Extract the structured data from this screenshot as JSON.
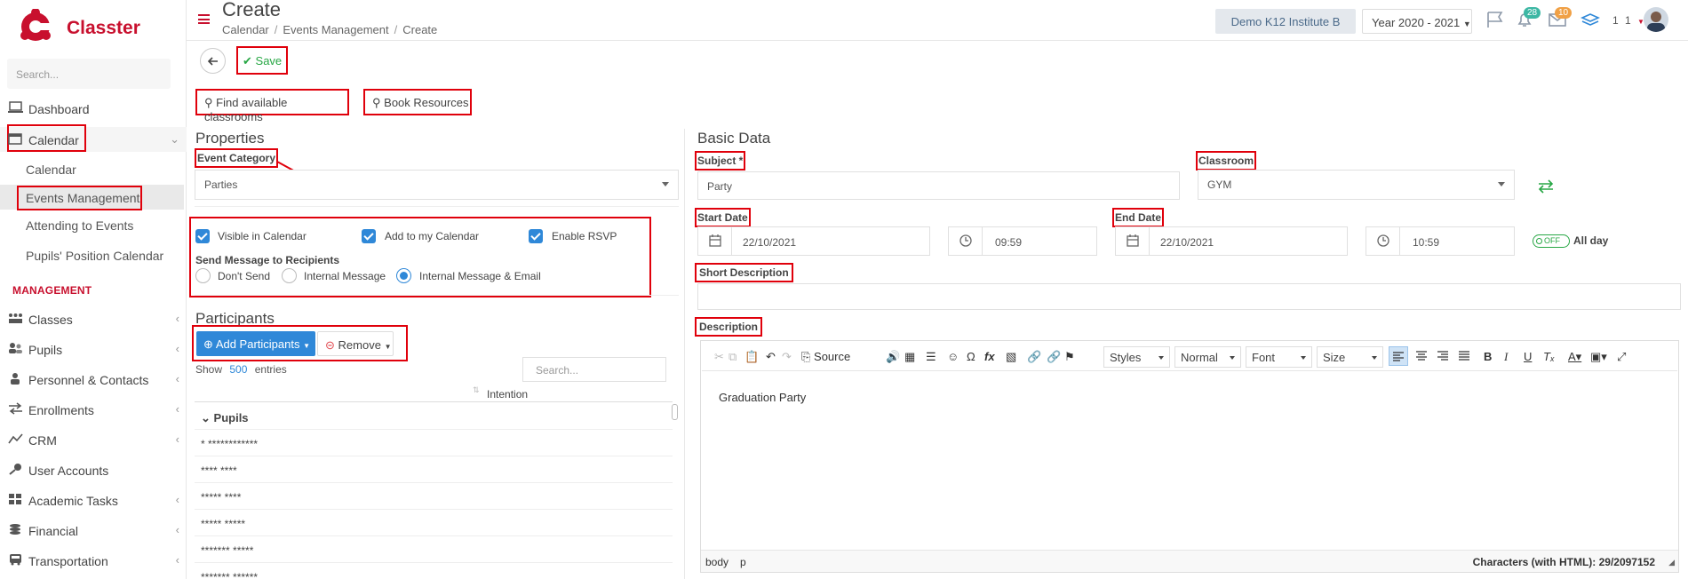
{
  "app": {
    "name": "Classter"
  },
  "sidebar": {
    "search_placeholder": "Search...",
    "items": [
      {
        "label": "Dashboard",
        "icon": "laptop-icon"
      },
      {
        "label": "Calendar",
        "icon": "calendar-icon"
      }
    ],
    "calendar_sub": [
      "Calendar",
      "Events Management",
      "Attending to Events",
      "Pupils' Position Calendar"
    ],
    "section_title": "MANAGEMENT",
    "management_items": [
      {
        "label": "Classes",
        "icon": "classes-icon"
      },
      {
        "label": "Pupils",
        "icon": "pupils-icon"
      },
      {
        "label": "Personnel & Contacts",
        "icon": "personnel-icon"
      },
      {
        "label": "Enrollments",
        "icon": "enrollments-icon"
      },
      {
        "label": "CRM",
        "icon": "crm-icon"
      },
      {
        "label": "User Accounts",
        "icon": "key-icon"
      },
      {
        "label": "Academic Tasks",
        "icon": "grid-icon"
      },
      {
        "label": "Financial",
        "icon": "coins-icon"
      },
      {
        "label": "Transportation",
        "icon": "bus-icon"
      }
    ]
  },
  "header": {
    "title": "Create",
    "breadcrumbs": [
      "Calendar",
      "Events Management",
      "Create"
    ],
    "institute": "Demo K12 Institute B",
    "year": "Year 2020 - 2021",
    "notifications_count": "28",
    "messages_count": "10",
    "user_label": "1 1"
  },
  "toolbar": {
    "save_label": "Save",
    "find_classrooms": "Find available classrooms",
    "book_resources": "Book Resources"
  },
  "properties": {
    "title": "Properties",
    "event_category_label": "Event Category",
    "event_category_value": "Parties",
    "visible_in_calendar": "Visible in Calendar",
    "add_to_my_calendar": "Add to my Calendar",
    "enable_rsvp": "Enable RSVP",
    "send_message_label": "Send Message to Recipients",
    "radio_options": [
      "Don't Send",
      "Internal Message",
      "Internal Message & Email"
    ],
    "radio_selected": "Internal Message & Email"
  },
  "participants": {
    "title": "Participants",
    "add_label": "Add Participants",
    "remove_label": "Remove",
    "show_label": "Show",
    "show_count": "500",
    "entries_label": "entries",
    "search_placeholder": "Search...",
    "column_intention": "Intention",
    "group_label": "Pupils",
    "rows": [
      "* ************",
      "**** ****",
      "***** ****",
      "***** *****",
      "******* *****",
      "******* ******"
    ]
  },
  "basic_data": {
    "title": "Basic Data",
    "subject_label": "Subject *",
    "subject_value": "Party",
    "classroom_label": "Classroom",
    "classroom_value": "GYM",
    "start_date_label": "Start Date",
    "start_date": "22/10/2021",
    "start_time": "09:59",
    "end_date_label": "End Date",
    "end_date": "22/10/2021",
    "end_time": "10:59",
    "all_day_toggle": "OFF",
    "all_day_label": "All day",
    "short_description_label": "Short Description",
    "description_label": "Description"
  },
  "editor": {
    "source_label": "Source",
    "styles_label": "Styles",
    "format_label": "Normal",
    "font_label": "Font",
    "size_label": "Size",
    "content": "Graduation Party",
    "path": [
      "body",
      "p"
    ],
    "char_count": "Characters (with HTML): 29/2097152"
  },
  "colors": {
    "brand": "#c8102e",
    "accent": "#2f88d8",
    "save": "#28a745",
    "annotation": "#e0000b"
  }
}
